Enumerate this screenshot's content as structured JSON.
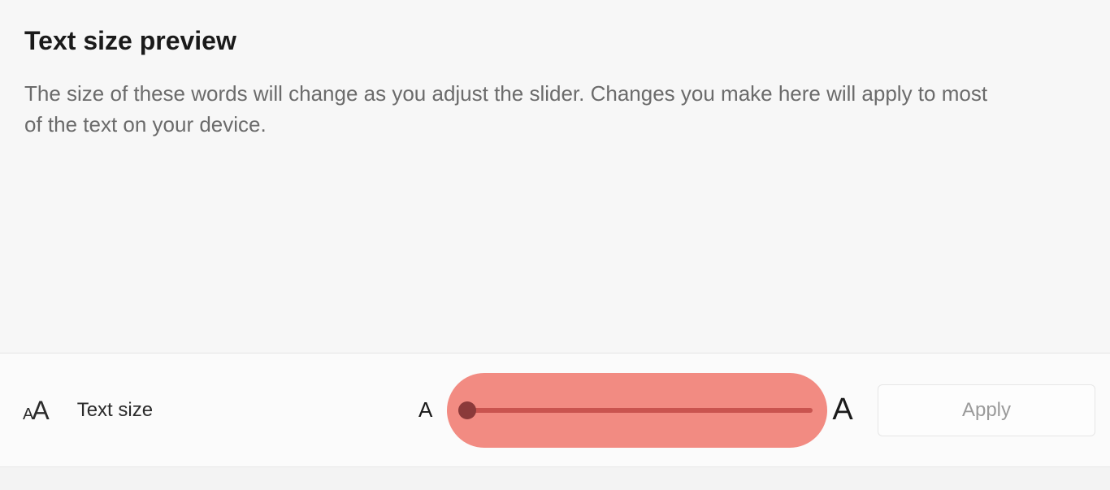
{
  "preview": {
    "title": "Text size preview",
    "description": "The size of these words will change as you adjust the slider. Changes you make here will apply to most of the text on your device."
  },
  "control": {
    "label": "Text size",
    "sliderLetterSmall": "A",
    "sliderLetterLarge": "A",
    "applyLabel": "Apply",
    "sliderValuePercent": 0
  }
}
